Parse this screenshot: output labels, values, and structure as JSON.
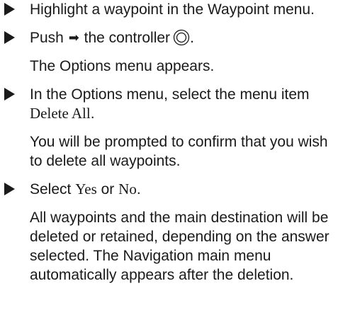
{
  "steps": [
    {
      "text": "Highlight a waypoint in the Waypoint menu."
    },
    {
      "text_before": "Push",
      "arrow": "➡",
      "text_after": "the controller",
      "icon": "controller-knob-icon",
      "punct": "."
    },
    {
      "para": "The Options menu appears."
    },
    {
      "text_before": "In the Options menu, select the menu item",
      "term": "Delete All",
      "punct": "."
    },
    {
      "para": "You will be prompted to confirm that you wish to delete all waypoints."
    },
    {
      "text_before": "Select",
      "term1": "Yes",
      "mid": "or",
      "term2": "No",
      "punct": "."
    },
    {
      "para": "All waypoints and the main destination will be deleted or retained, depending on the answer selected. The Navigation main menu automatically appears after the deletion."
    }
  ],
  "colors": {
    "text": "#1a1a1a",
    "background": "#ffffff"
  }
}
